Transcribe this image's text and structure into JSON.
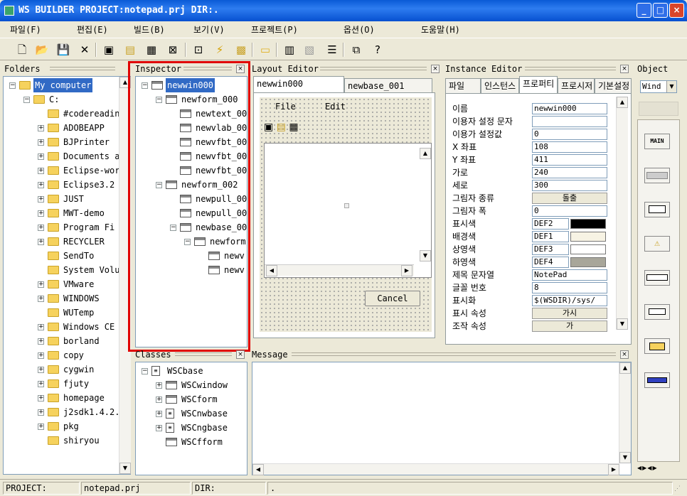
{
  "title": "WS BUILDER PROJECT:notepad.prj DIR:.",
  "window_buttons": {
    "minimize": "_",
    "maximize": "□",
    "close": "×"
  },
  "menus": [
    "파일(F)",
    "편집(E)",
    "빌드(B)",
    "보기(V)",
    "프로젝트(P)",
    "옵션(O)",
    "도움말(H)"
  ],
  "toolbar_icons": [
    "new-file-icon",
    "open-folder-icon",
    "save-icon",
    "cut-icon",
    "new-window-icon",
    "open-icon",
    "save-window-icon",
    "close-window-icon",
    "inspect-icon",
    "build-icon",
    "run-icon",
    "folder-icon",
    "calc-icon",
    "grid-icon",
    "list-icon",
    "preview-icon",
    "help-icon"
  ],
  "folders": {
    "title": "Folders",
    "items": [
      {
        "label": "My computer",
        "level": 0,
        "expander": "-",
        "selected": true
      },
      {
        "label": "C:",
        "level": 1,
        "expander": "-"
      },
      {
        "label": "#codereadin",
        "level": 2,
        "expander": ""
      },
      {
        "label": "ADOBEAPP",
        "level": 2,
        "expander": "+"
      },
      {
        "label": "BJPrinter",
        "level": 2,
        "expander": "+"
      },
      {
        "label": "Documents a",
        "level": 2,
        "expander": "+"
      },
      {
        "label": "Eclipse-wor",
        "level": 2,
        "expander": "+"
      },
      {
        "label": "Eclipse3.2",
        "level": 2,
        "expander": "+"
      },
      {
        "label": "JUST",
        "level": 2,
        "expander": "+"
      },
      {
        "label": "MWT-demo",
        "level": 2,
        "expander": "+"
      },
      {
        "label": "Program Fi",
        "level": 2,
        "expander": "+"
      },
      {
        "label": "RECYCLER",
        "level": 2,
        "expander": "+"
      },
      {
        "label": "SendTo",
        "level": 2,
        "expander": ""
      },
      {
        "label": "System Volu",
        "level": 2,
        "expander": ""
      },
      {
        "label": "VMware",
        "level": 2,
        "expander": "+"
      },
      {
        "label": "WINDOWS",
        "level": 2,
        "expander": "+"
      },
      {
        "label": "WUTemp",
        "level": 2,
        "expander": ""
      },
      {
        "label": "Windows CE",
        "level": 2,
        "expander": "+"
      },
      {
        "label": "borland",
        "level": 2,
        "expander": "+"
      },
      {
        "label": "copy",
        "level": 2,
        "expander": "+"
      },
      {
        "label": "cygwin",
        "level": 2,
        "expander": "+"
      },
      {
        "label": "fjuty",
        "level": 2,
        "expander": "+"
      },
      {
        "label": "homepage",
        "level": 2,
        "expander": "+"
      },
      {
        "label": "j2sdk1.4.2.",
        "level": 2,
        "expander": "+"
      },
      {
        "label": "pkg",
        "level": 2,
        "expander": "+"
      },
      {
        "label": "shiryou",
        "level": 2,
        "expander": ""
      }
    ]
  },
  "inspector": {
    "title": "Inspector",
    "items": [
      {
        "label": "newwin000",
        "level": 0,
        "expander": "-",
        "selected": true
      },
      {
        "label": "newform_000",
        "level": 1,
        "expander": "-"
      },
      {
        "label": "newtext_00",
        "level": 2,
        "expander": ""
      },
      {
        "label": "newvlab_00",
        "level": 2,
        "expander": ""
      },
      {
        "label": "newvfbt_00",
        "level": 2,
        "expander": ""
      },
      {
        "label": "newvfbt_00",
        "level": 2,
        "expander": ""
      },
      {
        "label": "newvfbt_00",
        "level": 2,
        "expander": ""
      },
      {
        "label": "newform_002",
        "level": 1,
        "expander": "-"
      },
      {
        "label": "newpull_00",
        "level": 2,
        "expander": ""
      },
      {
        "label": "newpull_00",
        "level": 2,
        "expander": ""
      },
      {
        "label": "newbase_00",
        "level": 2,
        "expander": "-"
      },
      {
        "label": "newform.",
        "level": 3,
        "expander": "-"
      },
      {
        "label": "newv",
        "level": 4,
        "expander": ""
      },
      {
        "label": "newv",
        "level": 4,
        "expander": ""
      }
    ]
  },
  "layout_editor": {
    "title": "Layout Editor",
    "tabs": [
      "newwin000",
      "newbase_001"
    ],
    "menu_file": "File",
    "menu_edit": "Edit",
    "cancel": "Cancel"
  },
  "instance_editor": {
    "title": "Instance Editor",
    "tabs": [
      "파일",
      "인스턴스",
      "프로퍼티",
      "프로시저",
      "기본설정"
    ],
    "props": [
      {
        "name": "이름",
        "value": "newwin000",
        "kind": "text"
      },
      {
        "name": "이용자 설정 문자",
        "value": "",
        "kind": "text"
      },
      {
        "name": "이용가 설정값",
        "value": "0",
        "kind": "text"
      },
      {
        "name": "X 좌표",
        "value": "108",
        "kind": "text"
      },
      {
        "name": "Y 좌표",
        "value": "411",
        "kind": "text"
      },
      {
        "name": "가로",
        "value": "240",
        "kind": "text"
      },
      {
        "name": "세로",
        "value": "300",
        "kind": "text"
      },
      {
        "name": "그림자 종류",
        "value": "돌출",
        "kind": "button"
      },
      {
        "name": "그림자 폭",
        "value": "0",
        "kind": "text"
      },
      {
        "name": "표시색",
        "value": "DEF2",
        "kind": "color",
        "swatch": "#000000"
      },
      {
        "name": "배경색",
        "value": "DEF1",
        "kind": "color",
        "swatch": "#f7f3e4"
      },
      {
        "name": "상영색",
        "value": "DEF3",
        "kind": "color",
        "swatch": "#ffffff"
      },
      {
        "name": "하영색",
        "value": "DEF4",
        "kind": "color",
        "swatch": "#a8a69a"
      },
      {
        "name": "제목 문자열",
        "value": "NotePad",
        "kind": "text"
      },
      {
        "name": "글꼴 번호",
        "value": "8",
        "kind": "text"
      },
      {
        "name": "표시화",
        "value": "$(WSDIR)/sys/",
        "kind": "text"
      },
      {
        "name": "표시 속성",
        "value": "가시",
        "kind": "button"
      },
      {
        "name": "조작 속성",
        "value": "가",
        "kind": "button"
      }
    ]
  },
  "object_panel": {
    "title": "Object",
    "select": "Wind",
    "buttons": [
      "MAIN",
      "",
      "",
      "",
      "",
      "",
      "",
      ""
    ]
  },
  "classes": {
    "title": "Classes",
    "items": [
      {
        "label": "WSCbase",
        "level": 0,
        "expander": "-",
        "icon": "doc"
      },
      {
        "label": "WSCwindow",
        "level": 1,
        "expander": "+",
        "icon": "win"
      },
      {
        "label": "WSCform",
        "level": 1,
        "expander": "+",
        "icon": "win"
      },
      {
        "label": "WSCnwbase",
        "level": 1,
        "expander": "+",
        "icon": "doc"
      },
      {
        "label": "WSCngbase",
        "level": 1,
        "expander": "+",
        "icon": "doc"
      },
      {
        "label": "WSCfform",
        "level": 1,
        "expander": "",
        "icon": "win"
      }
    ]
  },
  "message": {
    "title": "Message"
  },
  "status": {
    "project_label": "PROJECT:",
    "project": "notepad.prj",
    "dir_label": "DIR:",
    "dir": "."
  }
}
